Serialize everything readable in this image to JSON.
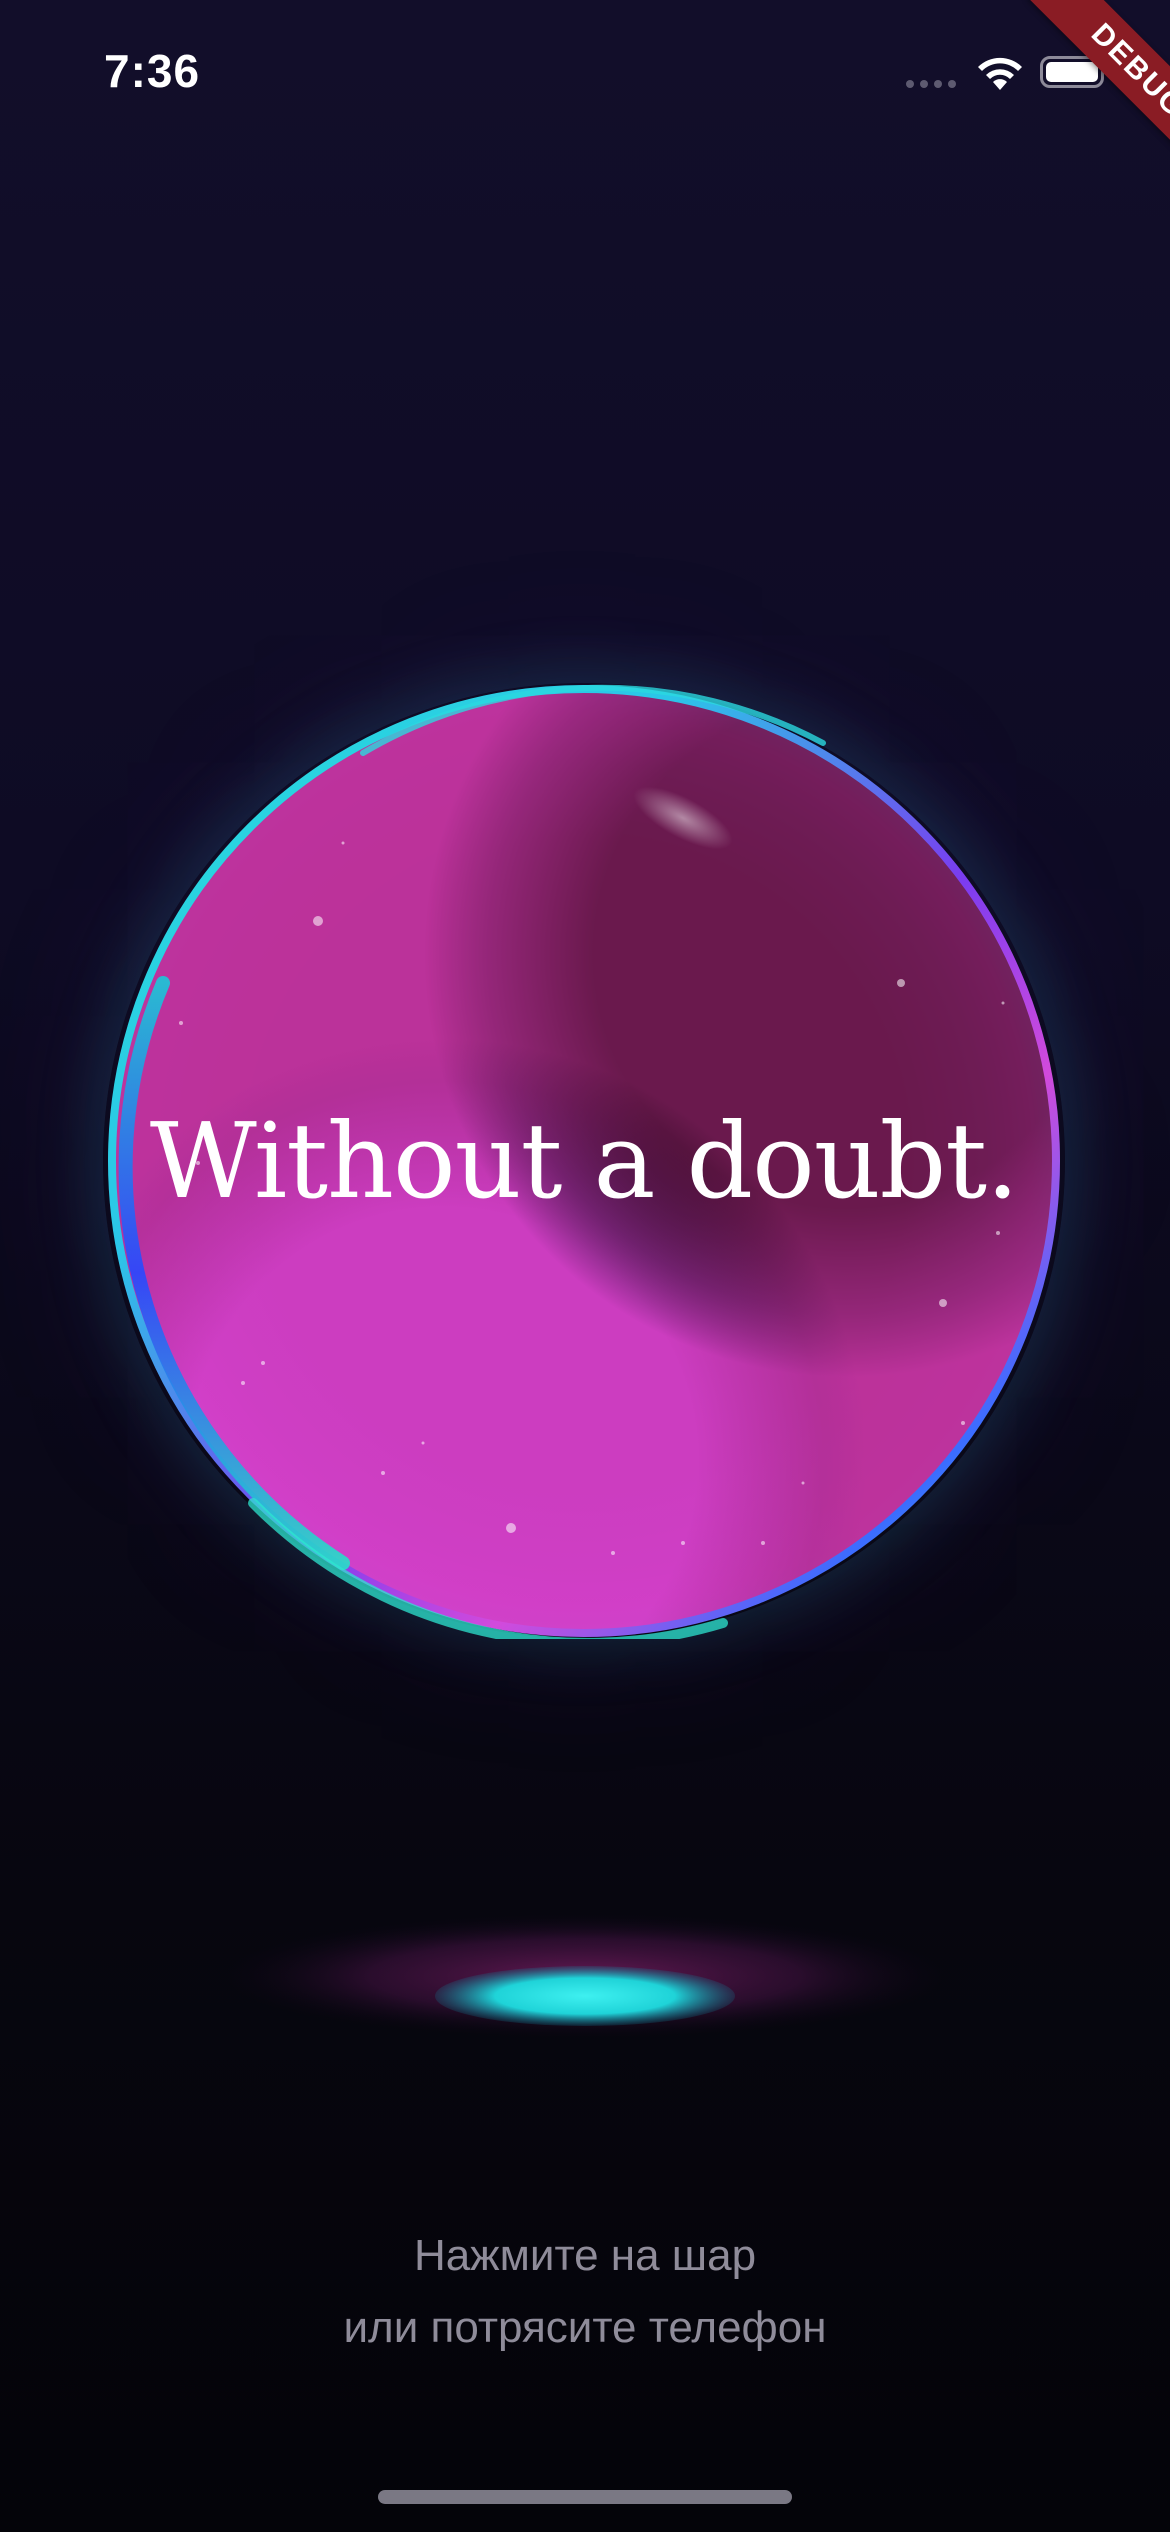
{
  "status_bar": {
    "time": "7:36",
    "icons": [
      "cellular-signal-icon",
      "wifi-icon",
      "battery-icon"
    ]
  },
  "debug_banner": {
    "label": "DEBUG",
    "color": "#8a1c24"
  },
  "orb": {
    "answer": "Without a doubt.",
    "colors": {
      "rim_primary": "#22d6d6",
      "rim_secondary": "#c23cc8",
      "rim_blue": "#2b5cff",
      "core": "#000000"
    }
  },
  "hint": {
    "line1": "Нажмите на шар",
    "line2": "или потрясите телефон"
  },
  "colors": {
    "background_top": "#120e2a",
    "background_bottom": "#040409",
    "hint_text": "#8f8c9a",
    "pedestal_glow": "#1fd3d8"
  }
}
